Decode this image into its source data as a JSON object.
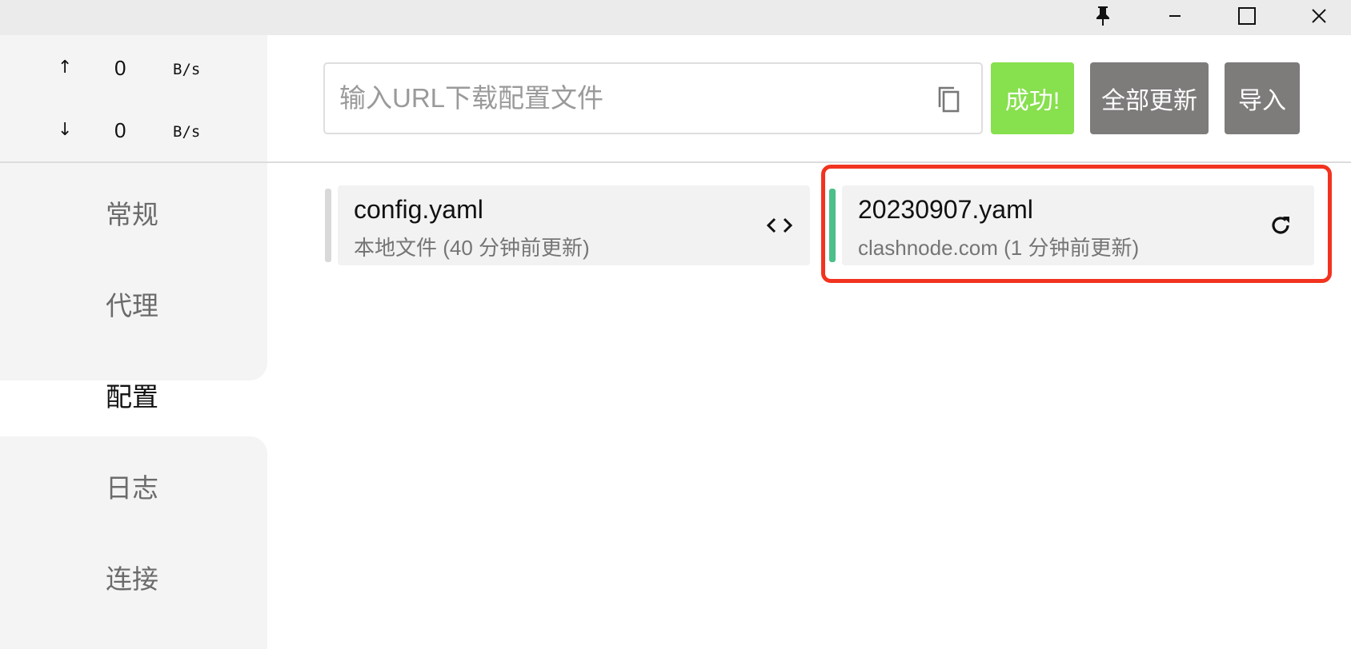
{
  "titlebar": {
    "pin_icon": "pin-icon",
    "minimize_icon": "minimize-icon",
    "maximize_icon": "maximize-icon",
    "close_icon": "close-icon"
  },
  "traffic": {
    "upload": {
      "arrow": "↑",
      "value": "0",
      "unit": "B/s"
    },
    "download": {
      "arrow": "↓",
      "value": "0",
      "unit": "B/s"
    }
  },
  "sidebar": {
    "items": [
      {
        "label": "常规",
        "active": false
      },
      {
        "label": "代理",
        "active": false
      },
      {
        "label": "配置",
        "active": true
      },
      {
        "label": "日志",
        "active": false
      },
      {
        "label": "连接",
        "active": false
      }
    ]
  },
  "header": {
    "url_placeholder": "输入URL下载配置文件",
    "url_value": "",
    "success_label": "成功!",
    "update_all_label": "全部更新",
    "import_label": "导入"
  },
  "profiles": [
    {
      "name": "config.yaml",
      "description": "本地文件 (40 分钟前更新)",
      "indicator_color": "#d9d9d9",
      "action_icon": "code-icon"
    },
    {
      "name": "20230907.yaml",
      "description": "clashnode.com (1 分钟前更新)",
      "indicator_color": "#4cbf8a",
      "action_icon": "refresh-icon"
    }
  ],
  "colors": {
    "success": "#87e04e",
    "button_gray": "#7e7b7b",
    "highlight": "#f2331f",
    "active_profile": "#4cbf8a"
  }
}
